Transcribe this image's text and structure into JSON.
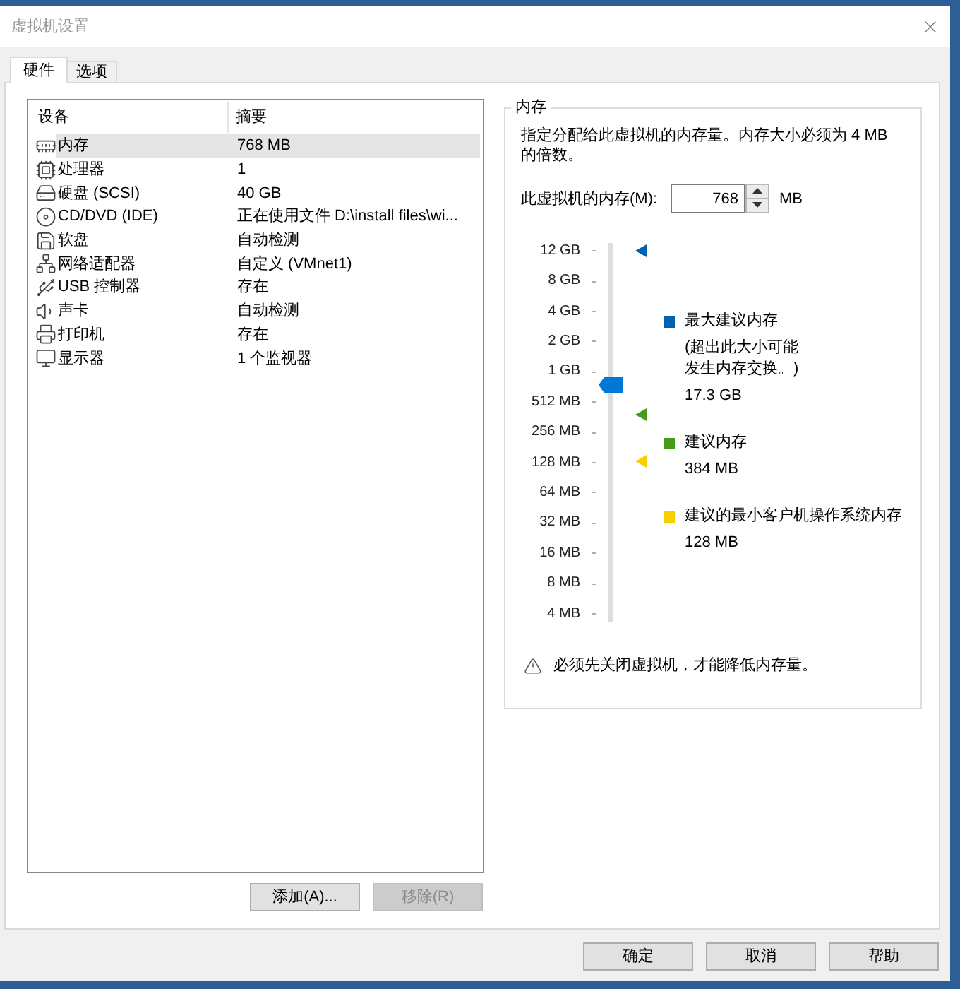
{
  "window": {
    "title": "虚拟机设置"
  },
  "tabs": [
    {
      "label": "硬件",
      "selected": true
    },
    {
      "label": "选项",
      "selected": false
    }
  ],
  "device_list": {
    "columns": [
      "设备",
      "摘要"
    ],
    "devices": [
      {
        "kind": "memory",
        "name": "内存",
        "summary": "768 MB",
        "selected": true
      },
      {
        "kind": "cpu",
        "name": "处理器",
        "summary": "1",
        "selected": false
      },
      {
        "kind": "disk",
        "name": "硬盘 (SCSI)",
        "summary": "40 GB",
        "selected": false
      },
      {
        "kind": "cd",
        "name": "CD/DVD (IDE)",
        "summary": "正在使用文件 D:\\install files\\wi...",
        "selected": false
      },
      {
        "kind": "floppy",
        "name": "软盘",
        "summary": "自动检测",
        "selected": false
      },
      {
        "kind": "network",
        "name": "网络适配器",
        "summary": "自定义 (VMnet1)",
        "selected": false
      },
      {
        "kind": "usb",
        "name": "USB 控制器",
        "summary": "存在",
        "selected": false
      },
      {
        "kind": "sound",
        "name": "声卡",
        "summary": "自动检测",
        "selected": false
      },
      {
        "kind": "printer",
        "name": "打印机",
        "summary": "存在",
        "selected": false
      },
      {
        "kind": "display",
        "name": "显示器",
        "summary": "1 个监视器",
        "selected": false
      }
    ]
  },
  "list_buttons": [
    {
      "label": "添加(A)...",
      "disabled": false
    },
    {
      "label": "移除(R)",
      "disabled": true
    }
  ],
  "memory": {
    "title": "内存",
    "description": "指定分配给此虚拟机的内存量。内存大小必须为 4 MB 的倍数。",
    "field_label": "此虚拟机的内存(M):",
    "value": "768",
    "unit": "MB",
    "slider": {
      "level": 0.632,
      "scale": [
        "12 GB",
        "8 GB",
        "4 GB",
        "2 GB",
        "1 GB",
        "512 MB",
        "256 MB",
        "128 MB",
        "64 MB",
        "32 MB",
        "16 MB",
        "8 MB",
        "4 MB"
      ],
      "markers": [
        {
          "color": "#0063b1",
          "level": 1
        },
        {
          "color": "#459a1c",
          "level": 0.551
        },
        {
          "color": "#f5d000",
          "level": 0.42
        }
      ]
    },
    "recommendations": [
      {
        "label": "最大建议内存",
        "note": "(超出此大小可能发生内存交换。)",
        "value": "17.3 GB",
        "color": "#0063b1"
      },
      {
        "label": "建议内存",
        "value": "384 MB",
        "color": "#459a1c"
      },
      {
        "label": "建议的最小客户机操作系统内存",
        "value": "128 MB",
        "color": "#f5d000"
      }
    ],
    "warning": "必须先关闭虚拟机，才能降低内存量。"
  },
  "buttons": [
    "确定",
    "取消",
    "帮助"
  ]
}
